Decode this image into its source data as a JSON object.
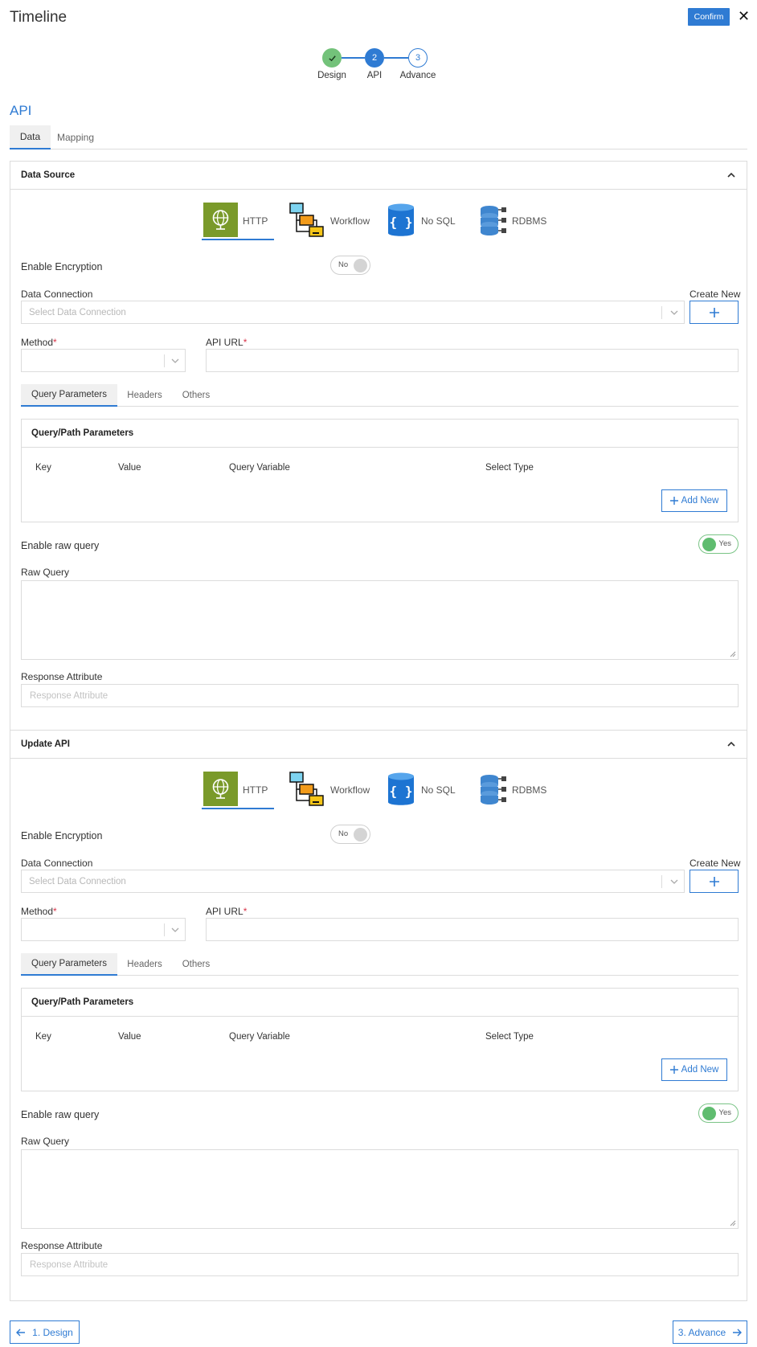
{
  "header": {
    "title": "Timeline",
    "confirm_label": "Confirm"
  },
  "stepper": {
    "steps": [
      {
        "number": "",
        "label": "Design",
        "state": "done"
      },
      {
        "number": "2",
        "label": "API",
        "state": "active"
      },
      {
        "number": "3",
        "label": "Advance",
        "state": "pending"
      }
    ]
  },
  "section_title": "API",
  "main_tabs": [
    {
      "label": "Data"
    },
    {
      "label": "Mapping"
    }
  ],
  "panels": [
    {
      "title": "Data Source",
      "sources": [
        {
          "label": "HTTP"
        },
        {
          "label": "Workflow"
        },
        {
          "label": "No SQL"
        },
        {
          "label": "RDBMS"
        }
      ],
      "encryption": {
        "label": "Enable Encryption",
        "value": "No"
      },
      "connection": {
        "label": "Data Connection",
        "placeholder": "Select Data Connection",
        "create_label": "Create New"
      },
      "method": {
        "label": "Method"
      },
      "api_url": {
        "label": "API URL"
      },
      "sub_tabs": [
        {
          "label": "Query Parameters"
        },
        {
          "label": "Headers"
        },
        {
          "label": "Others"
        }
      ],
      "params": {
        "title": "Query/Path Parameters",
        "columns": [
          "Key",
          "Value",
          "Query Variable",
          "Select Type"
        ],
        "add_label": "Add New"
      },
      "raw_toggle": {
        "label": "Enable raw query",
        "value": "Yes"
      },
      "raw_query": {
        "label": "Raw Query"
      },
      "response": {
        "label": "Response Attribute",
        "placeholder": "Response Attribute"
      }
    },
    {
      "title": "Update API",
      "sources": [
        {
          "label": "HTTP"
        },
        {
          "label": "Workflow"
        },
        {
          "label": "No SQL"
        },
        {
          "label": "RDBMS"
        }
      ],
      "encryption": {
        "label": "Enable Encryption",
        "value": "No"
      },
      "connection": {
        "label": "Data Connection",
        "placeholder": "Select Data Connection",
        "create_label": "Create New"
      },
      "method": {
        "label": "Method"
      },
      "api_url": {
        "label": "API URL"
      },
      "sub_tabs": [
        {
          "label": "Query Parameters"
        },
        {
          "label": "Headers"
        },
        {
          "label": "Others"
        }
      ],
      "params": {
        "title": "Query/Path Parameters",
        "columns": [
          "Key",
          "Value",
          "Query Variable",
          "Select Type"
        ],
        "add_label": "Add New"
      },
      "raw_toggle": {
        "label": "Enable raw query",
        "value": "Yes"
      },
      "raw_query": {
        "label": "Raw Query"
      },
      "response": {
        "label": "Response Attribute",
        "placeholder": "Response Attribute"
      }
    }
  ],
  "required_mark": "*",
  "footer": {
    "back_label": "1. Design",
    "next_label": "3. Advance"
  },
  "colors": {
    "accent": "#2f7bd3",
    "done": "#73c27a",
    "required": "#d9364a",
    "http_green": "#7a9a2a"
  },
  "icons": {
    "http": "globe-icon",
    "workflow": "workflow-icon",
    "nosql": "nosql-icon",
    "rdbms": "database-icon"
  }
}
